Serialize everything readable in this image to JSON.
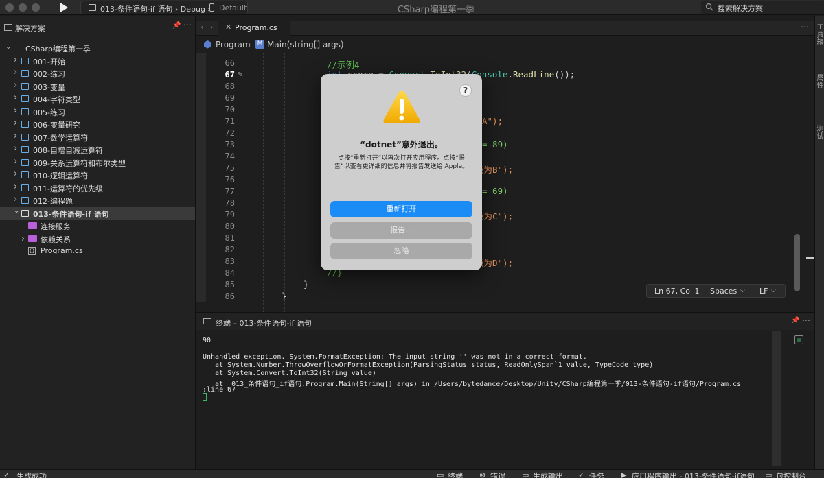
{
  "window": {
    "title": "CSharp编程第一季",
    "scheme": "013-条件语句-if 语句 › Debug ›",
    "device": "Default",
    "search_placeholder": "搜索解决方案"
  },
  "sidebar": {
    "title": "解决方案",
    "solution": "CSharp编程第一季",
    "items": [
      {
        "label": "001-开始"
      },
      {
        "label": "002-练习"
      },
      {
        "label": "003-变量"
      },
      {
        "label": "004-字符类型"
      },
      {
        "label": "005-练习"
      },
      {
        "label": "006-变量研究"
      },
      {
        "label": "007-数学运算符"
      },
      {
        "label": "008-自增自减运算符"
      },
      {
        "label": "009-关系运算符和布尔类型"
      },
      {
        "label": "010-逻辑运算符"
      },
      {
        "label": "011-运算符的优先级"
      },
      {
        "label": "012-编程题"
      },
      {
        "label": "013-条件语句-if 语句"
      }
    ],
    "children": [
      {
        "label": "连接服务"
      },
      {
        "label": "依赖关系"
      },
      {
        "label": "Program.cs"
      }
    ]
  },
  "editor": {
    "tab": "Program.cs",
    "breadcrumb_class": "Program",
    "breadcrumb_method": "Main(string[] args)",
    "lines": [
      {
        "n": "66",
        "indent": 1,
        "text": "//示例4",
        "color": "#5fbf4f"
      },
      {
        "n": "67",
        "indent": 1,
        "text": "int score = Convert.ToInt32(Console.ReadLine());",
        "color": "#d4d4d4"
      },
      {
        "n": "68",
        "indent": 1,
        "text": "",
        "color": "#d4d4d4"
      },
      {
        "n": "69",
        "indent": 1,
        "text": "",
        "color": "#d4d4d4"
      },
      {
        "n": "70",
        "indent": 1,
        "text": "",
        "color": "#d4d4d4"
      },
      {
        "n": "71",
        "indent": 1,
        "text": "A\");",
        "color": "#d4d4d4"
      },
      {
        "n": "72",
        "indent": 1,
        "text": "",
        "color": "#d4d4d4"
      },
      {
        "n": "73",
        "indent": 1,
        "text": "= 89)",
        "color": "#d4d4d4"
      },
      {
        "n": "74",
        "indent": 1,
        "text": "",
        "color": "#d4d4d4"
      },
      {
        "n": "75",
        "indent": 1,
        "text": "级为B\");",
        "color": "#d4d4d4"
      },
      {
        "n": "76",
        "indent": 1,
        "text": "",
        "color": "#d4d4d4"
      },
      {
        "n": "77",
        "indent": 1,
        "text": "= 69)",
        "color": "#d4d4d4"
      },
      {
        "n": "78",
        "indent": 1,
        "text": "",
        "color": "#d4d4d4"
      },
      {
        "n": "79",
        "indent": 1,
        "text": "级为C\");",
        "color": "#d4d4d4"
      },
      {
        "n": "80",
        "indent": 1,
        "text": "",
        "color": "#d4d4d4"
      },
      {
        "n": "81",
        "indent": 1,
        "text": "",
        "color": "#d4d4d4"
      },
      {
        "n": "82",
        "indent": 1,
        "text": "",
        "color": "#d4d4d4"
      },
      {
        "n": "83",
        "indent": 1,
        "text": "级为D\");",
        "color": "#d4d4d4"
      },
      {
        "n": "84",
        "indent": 1,
        "text": "//}",
        "color": "#5fbf4f"
      },
      {
        "n": "85",
        "indent": 2,
        "text": "}",
        "color": "#d4d4d4"
      },
      {
        "n": "86",
        "indent": 3,
        "text": "}",
        "color": "#d4d4d4"
      }
    ],
    "status": {
      "position": "Ln 67, Col 1",
      "indent": "Spaces",
      "eol": "LF"
    }
  },
  "right_strip": [
    "工具箱",
    "属性",
    "测试"
  ],
  "terminal": {
    "title": "终端 – 013-条件语句-if 语句",
    "lines": [
      "90",
      "",
      "Unhandled exception. System.FormatException: The input string '' was not in a correct format.",
      "   at System.Number.ThrowOverflowOrFormatException(ParsingStatus status, ReadOnlySpan`1 value, TypeCode type)",
      "   at System.Convert.ToInt32(String value)",
      "   at _013_条件语句_if语句.Program.Main(String[] args) in /Users/bytedance/Desktop/Unity/CSharp编程第一季/013-条件语句-if语句/Program.cs",
      ":line 67"
    ]
  },
  "bottom_bar": {
    "build_status": "生成成功",
    "items": [
      "终端",
      "错误",
      "生成输出",
      "任务",
      "应用程序输出 - 013-条件语句-if语句",
      "包控制台"
    ]
  },
  "dialog": {
    "title": "“dotnet”意外退出。",
    "message": "点按“重新打开”以再次打开应用程序。点按“报告”以查看更详细的信息并将报告发送给 Apple。",
    "reopen": "重新打开",
    "report": "报告...",
    "ignore": "忽略",
    "help": "?"
  },
  "colors": {
    "accent": "#1b8cf6",
    "keyword": "#4f8fd6",
    "comment": "#5fbf4f",
    "string": "#e8925c",
    "warning": "#f5b800"
  }
}
